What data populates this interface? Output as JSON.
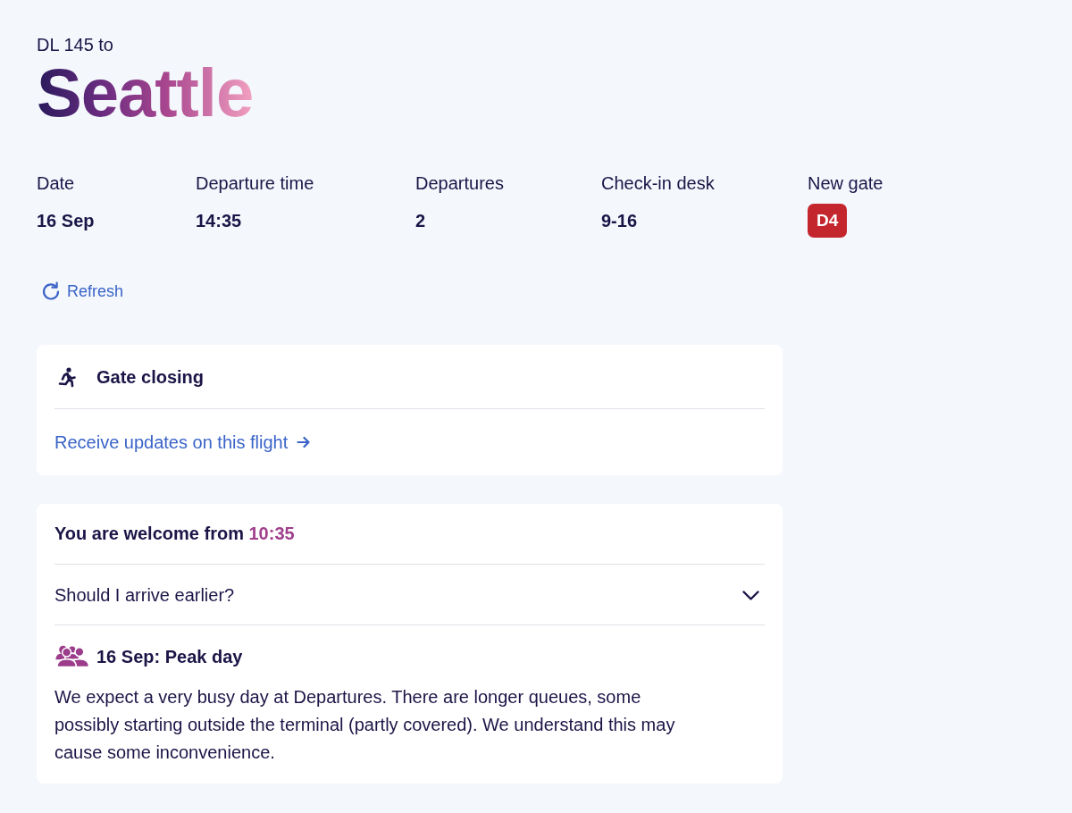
{
  "header": {
    "flight_line": "DL 145 to",
    "destination": "Seattle"
  },
  "details": [
    {
      "label": "Date",
      "value": "16 Sep",
      "kind": "text"
    },
    {
      "label": "Departure time",
      "value": "14:35",
      "kind": "text"
    },
    {
      "label": "Departures",
      "value": "2",
      "kind": "text"
    },
    {
      "label": "Check-in desk",
      "value": "9-16",
      "kind": "text"
    },
    {
      "label": "New gate",
      "value": "D4",
      "kind": "badge"
    }
  ],
  "refresh": {
    "label": "Refresh"
  },
  "gate_card": {
    "status": "Gate closing",
    "link": "Receive updates on this flight"
  },
  "welcome_card": {
    "title": "You are welcome from",
    "time": "10:35",
    "question": {
      "label": "Should I arrive earlier?",
      "expanded": false
    },
    "notice": {
      "title": "16 Sep: Peak day",
      "text": "We expect a very busy day at Departures. There are longer queues, some possibly starting outside the terminal (partly covered). We understand this may cause some inconvenience."
    }
  }
}
